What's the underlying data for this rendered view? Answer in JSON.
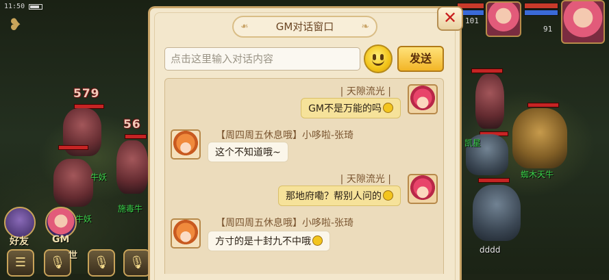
{
  "status": {
    "time": "11:50"
  },
  "hud": {
    "damage_numbers": [
      "579",
      "56"
    ],
    "mob_names": [
      "牛妖",
      "施毒牛",
      "牛妖",
      "凯星",
      "蜘木天牛",
      "dddd"
    ],
    "top_right_values": [
      "101",
      "91"
    ],
    "side_buttons": {
      "friends": "好友",
      "gm": "GM",
      "world": "世"
    }
  },
  "dialog": {
    "title": "GM对话窗口",
    "input_placeholder": "点击这里输入对话内容",
    "send_label": "发送"
  },
  "messages": [
    {
      "direction": "out",
      "sender": "| 天隙流光 |",
      "text": "GM不是万能的吗",
      "emoji": true
    },
    {
      "direction": "in",
      "sender": "【周四周五休息哦】小哆啦-张琦",
      "text": "这个不知道哦~",
      "emoji": false
    },
    {
      "direction": "out",
      "sender": "| 天隙流光 |",
      "text": "那地府嘞？帮别人问的",
      "emoji": true
    },
    {
      "direction": "in",
      "sender": "【周四周五休息哦】小哆啦-张琦",
      "text": "方寸的是十封九不中哦",
      "emoji": true
    }
  ]
}
